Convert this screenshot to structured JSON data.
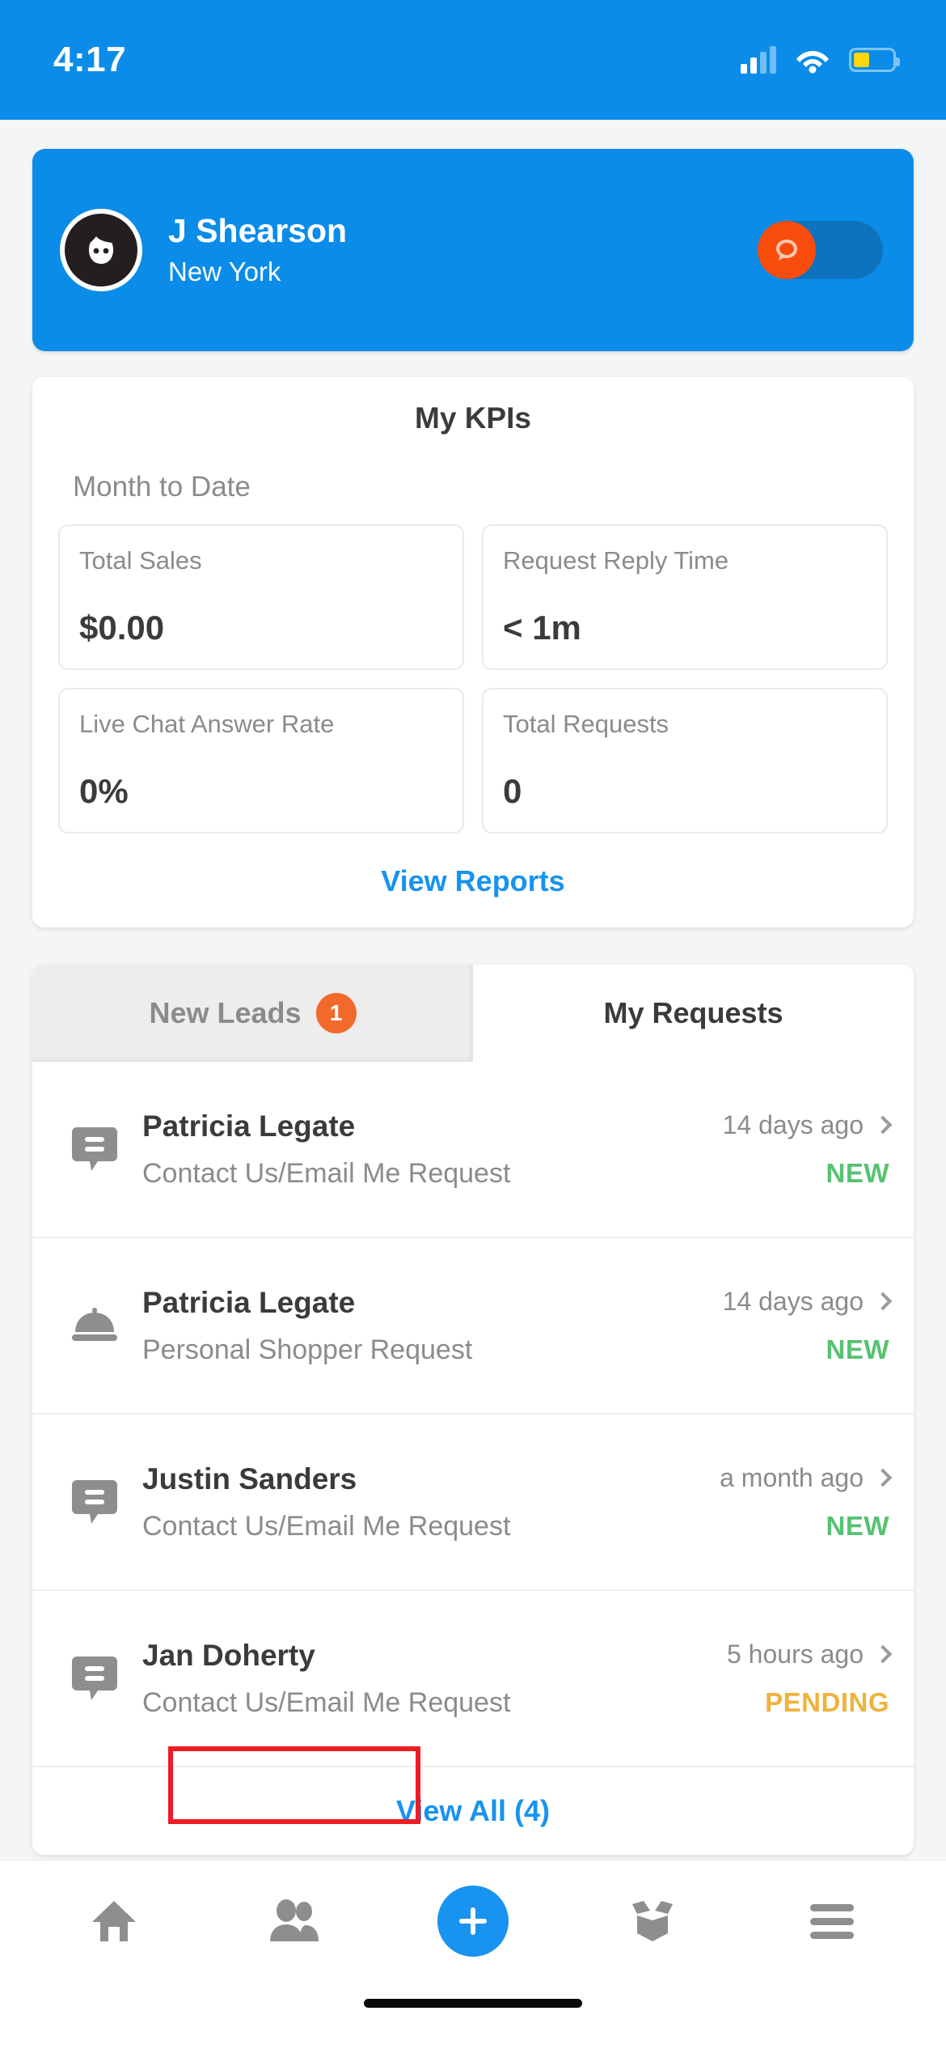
{
  "status_bar": {
    "time": "4:17",
    "signal_icon": "signal-bars-icon",
    "wifi_icon": "wifi-icon",
    "battery_icon": "battery-icon",
    "battery_level_percent": 42
  },
  "profile": {
    "avatar_icon": "user-avatar-icon",
    "name": "J Shearson",
    "location": "New York",
    "toggle": {
      "name": "availability-toggle",
      "state": "off",
      "knob_icon": "chat-bubble-icon",
      "knob_color": "#f84c0c",
      "track_color": "#0e73bf"
    },
    "background_color": "#0b8ce8"
  },
  "kpi": {
    "title": "My KPIs",
    "subtitle": "Month to Date",
    "tiles": [
      {
        "label": "Total Sales",
        "value": "$0.00"
      },
      {
        "label": "Request Reply Time",
        "value": "< 1m"
      },
      {
        "label": "Live Chat Answer Rate",
        "value": "0%"
      },
      {
        "label": "Total Requests",
        "value": "0"
      }
    ],
    "view_reports_label": "View Reports",
    "link_color": "#1893ef"
  },
  "leads_panel": {
    "tabs": [
      {
        "label": "New Leads",
        "badge": "1",
        "active": false,
        "badge_color": "#f2692c"
      },
      {
        "label": "My Requests",
        "badge": "",
        "active": true
      }
    ],
    "rows": [
      {
        "icon": "message-bubble-icon",
        "name": "Patricia Legate",
        "description": "Contact Us/Email Me Request",
        "time": "14 days ago",
        "status": "NEW",
        "status_color": "#56c271"
      },
      {
        "icon": "cloche-service-icon",
        "name": "Patricia Legate",
        "description": "Personal Shopper Request",
        "time": "14 days ago",
        "status": "NEW",
        "status_color": "#56c271"
      },
      {
        "icon": "message-bubble-icon",
        "name": "Justin Sanders",
        "description": "Contact Us/Email Me Request",
        "time": "a month ago",
        "status": "NEW",
        "status_color": "#56c271"
      },
      {
        "icon": "message-bubble-icon",
        "name": "Jan Doherty",
        "description": "Contact Us/Email Me Request",
        "time": "5 hours ago",
        "status": "PENDING",
        "status_color": "#eeb33c"
      }
    ],
    "view_all_label": "View All (4)",
    "annotation_color": "#ec1c24"
  },
  "bottom_nav": {
    "items": [
      {
        "icon": "home-icon",
        "label": ""
      },
      {
        "icon": "people-icon",
        "label": ""
      },
      {
        "icon": "plus-icon",
        "label": ""
      },
      {
        "icon": "open-box-icon",
        "label": ""
      },
      {
        "icon": "hamburger-menu-icon",
        "label": ""
      }
    ],
    "accent_color": "#1893ef"
  }
}
